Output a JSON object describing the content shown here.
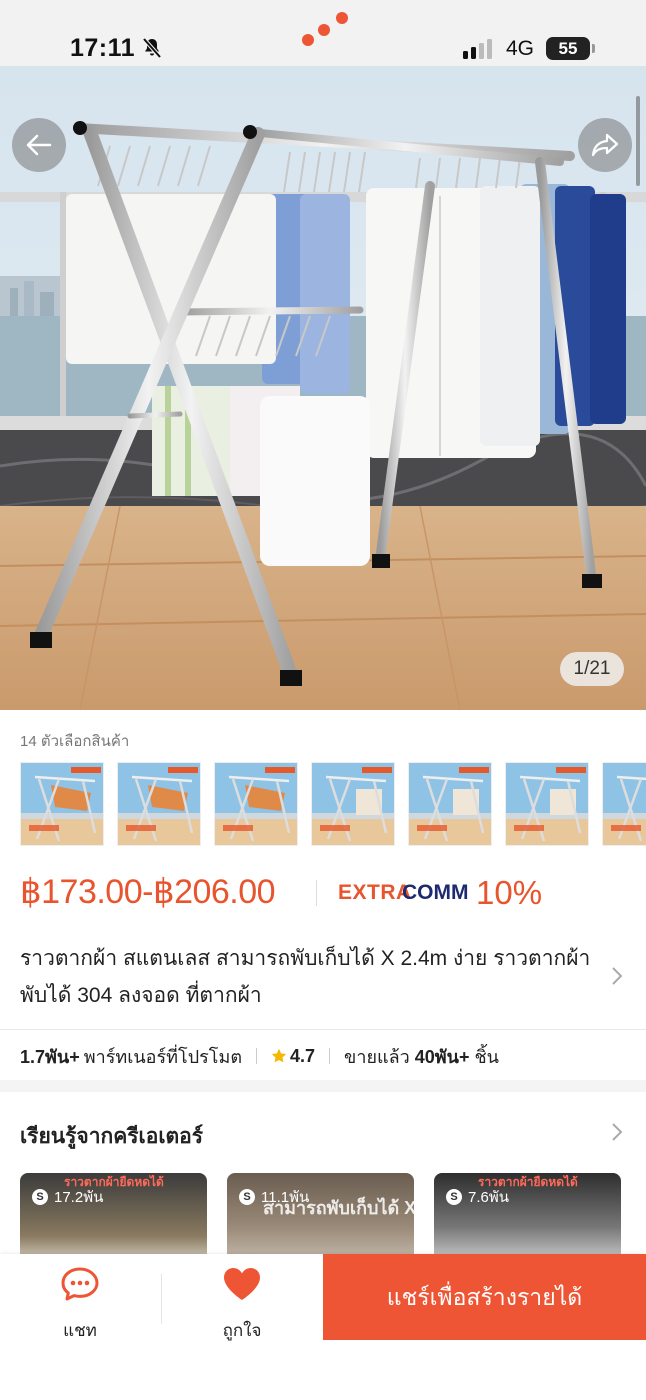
{
  "status_bar": {
    "time": "17:11",
    "network": "4G",
    "battery": "55"
  },
  "hero": {
    "page_indicator": "1/21"
  },
  "variants": {
    "label": "14 ตัวเลือกสินค้า",
    "thumb_count": 7
  },
  "price": {
    "range": "฿173.00-฿206.00",
    "extra_label": "EXTRA",
    "comm_label": "COMM",
    "comm_rate": "10%"
  },
  "product": {
    "title": "ราวตากผ้า สแตนเลส สามารถพับเก็บได้ X 2.4m ง่าย ราวตากผ้าพับได้ 304 ลงจอด ที่ตากผ้า"
  },
  "stats": {
    "partners_count": "1.7พัน+",
    "partners_label": "พาร์ทเนอร์ที่โปรโมต",
    "rating": "4.7",
    "sold_label": "ขายแล้ว",
    "sold_count": "40พัน+",
    "sold_unit": "ชิ้น"
  },
  "creators": {
    "title": "เรียนรู้จากครีเอเตอร์",
    "videos": [
      {
        "views": "17.2พัน",
        "caption": "ราวตากผ้ายืดหดได้"
      },
      {
        "views": "11.1พัน",
        "caption": "สามารถพับเก็บได้ X"
      },
      {
        "views": "7.6พัน",
        "caption": "ราวตากผ้ายืดหดได้"
      }
    ]
  },
  "bottom_bar": {
    "chat_label": "แชท",
    "like_label": "ถูกใจ",
    "share_button": "แชร์เพื่อสร้างรายได้"
  },
  "colors": {
    "accent": "#ee5535",
    "price": "#e8542e",
    "comm_navy": "#1c2a70",
    "star": "#f5b800"
  },
  "icons": [
    "bell-muted-icon",
    "signal-icon",
    "back-arrow-icon",
    "share-icon",
    "chevron-right-icon",
    "star-icon",
    "chat-icon",
    "heart-icon"
  ]
}
